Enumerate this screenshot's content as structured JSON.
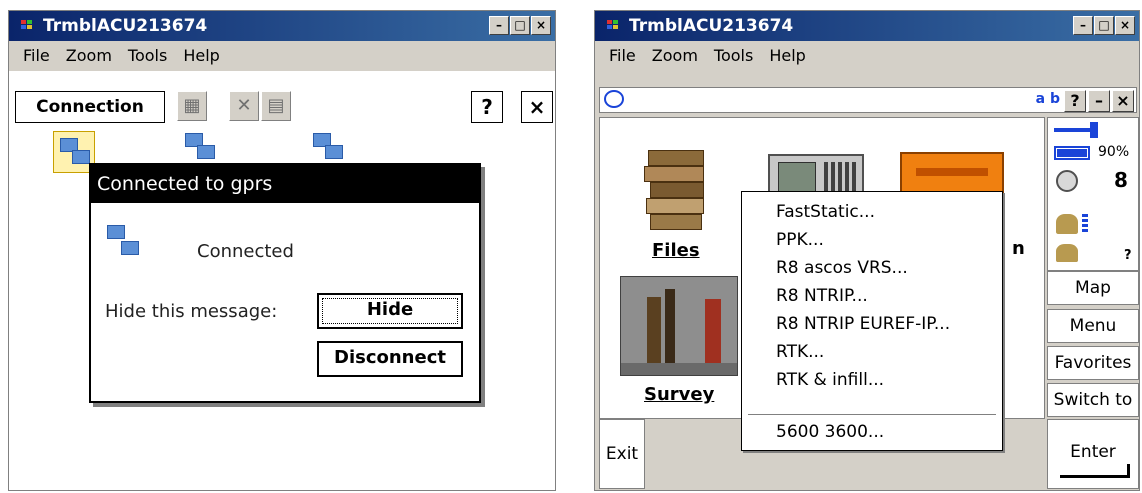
{
  "left_window": {
    "title": "TrmblACU213674",
    "menu": [
      "File",
      "Zoom",
      "Tools",
      "Help"
    ],
    "toolbar": {
      "connection_label": "Connection",
      "help_label": "?",
      "close_label": "×"
    },
    "dialog": {
      "title": "Connected to gprs",
      "status": "Connected",
      "hide_prompt": "Hide this message:",
      "hide_button": "Hide",
      "disconnect_button": "Disconnect"
    }
  },
  "right_window": {
    "title": "TrmblACU213674",
    "menu": [
      "File",
      "Zoom",
      "Tools",
      "Help"
    ],
    "cmdbar": {
      "ab_label": "a b",
      "help_label": "?",
      "minimize_label": "–",
      "close_label": "×"
    },
    "apps": {
      "files_label": "Files",
      "survey_label": "Survey",
      "partial_label": "n"
    },
    "status": {
      "battery": "90%",
      "satellites": "8",
      "unknown": "?"
    },
    "side_buttons": [
      "Map",
      "Menu",
      "Favorites",
      "Switch to"
    ],
    "exit_label": "Exit",
    "enter_label": "Enter",
    "dropdown_items": [
      "FastStatic...",
      "PPK...",
      "R8 ascos VRS...",
      "R8 NTRIP...",
      "R8 NTRIP EUREF-IP...",
      "RTK...",
      "RTK & infill..."
    ],
    "dropdown_last": "5600 3600..."
  },
  "colors": {
    "titlebar_start": "#0a246a",
    "titlebar_end": "#3a6ea5",
    "chrome": "#d4d0c8",
    "accent": "#1a44d8"
  }
}
